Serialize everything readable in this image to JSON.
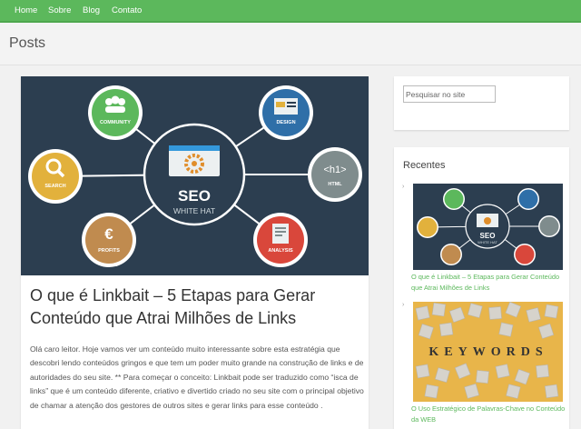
{
  "nav": {
    "items": [
      {
        "label": "Home"
      },
      {
        "label": "Sobre"
      },
      {
        "label": "Blog"
      },
      {
        "label": "Contato"
      }
    ],
    "bar_color": "#5cb85c"
  },
  "page": {
    "title": "Posts"
  },
  "post": {
    "image": {
      "center_title": "SEO",
      "center_subtitle": "WHITE HAT",
      "nodes": [
        {
          "label": "COMMUNITY",
          "color": "#5cb85c",
          "icon": "people-icon"
        },
        {
          "label": "DESIGN",
          "color": "#2f6fa8",
          "icon": "monitor-icon"
        },
        {
          "label": "SEARCH",
          "color": "#e2b13c",
          "icon": "magnifier-icon"
        },
        {
          "label": "HTML",
          "color": "#7f8c8d",
          "icon": "h1-tag-icon",
          "glyph": "<h1>"
        },
        {
          "label": "PROFITS",
          "color": "#c08b4f",
          "icon": "euro-icon",
          "glyph": "€"
        },
        {
          "label": "ANALYSIS",
          "color": "#d9473b",
          "icon": "report-icon"
        }
      ],
      "background": "#2c3e50"
    },
    "title": "O que é Linkbait – 5 Etapas para Gerar Conteúdo que Atrai Milhões de Links",
    "excerpt": "Olá caro leitor. Hoje vamos ver um conteúdo muito interessante sobre esta estratégia que descobri lendo conteúdos gringos e que tem um poder muito grande na construção de links e de autoridades do seu site. ** Para começar o conceito: Linkbait pode ser traduzido como “isca de links” que é um conteúdo diferente, criativo e divertido criado no seu site com o principal objetivo de chamar a atenção dos gestores de outros sites e gerar links para esse conteúdo ."
  },
  "sidebar": {
    "search": {
      "placeholder": "Pesquisar no site"
    },
    "recent": {
      "title": "Recentes",
      "items": [
        {
          "label": "O que é Linkbait – 5 Etapas para Gerar Conteúdo que Atrai Milhões de Links"
        },
        {
          "label": "O Uso Estratégico de Palavras-Chave no Conteúdo da WEB",
          "thumb_word": "KEYWORDS"
        }
      ]
    },
    "link_color": "#5cb85c"
  }
}
